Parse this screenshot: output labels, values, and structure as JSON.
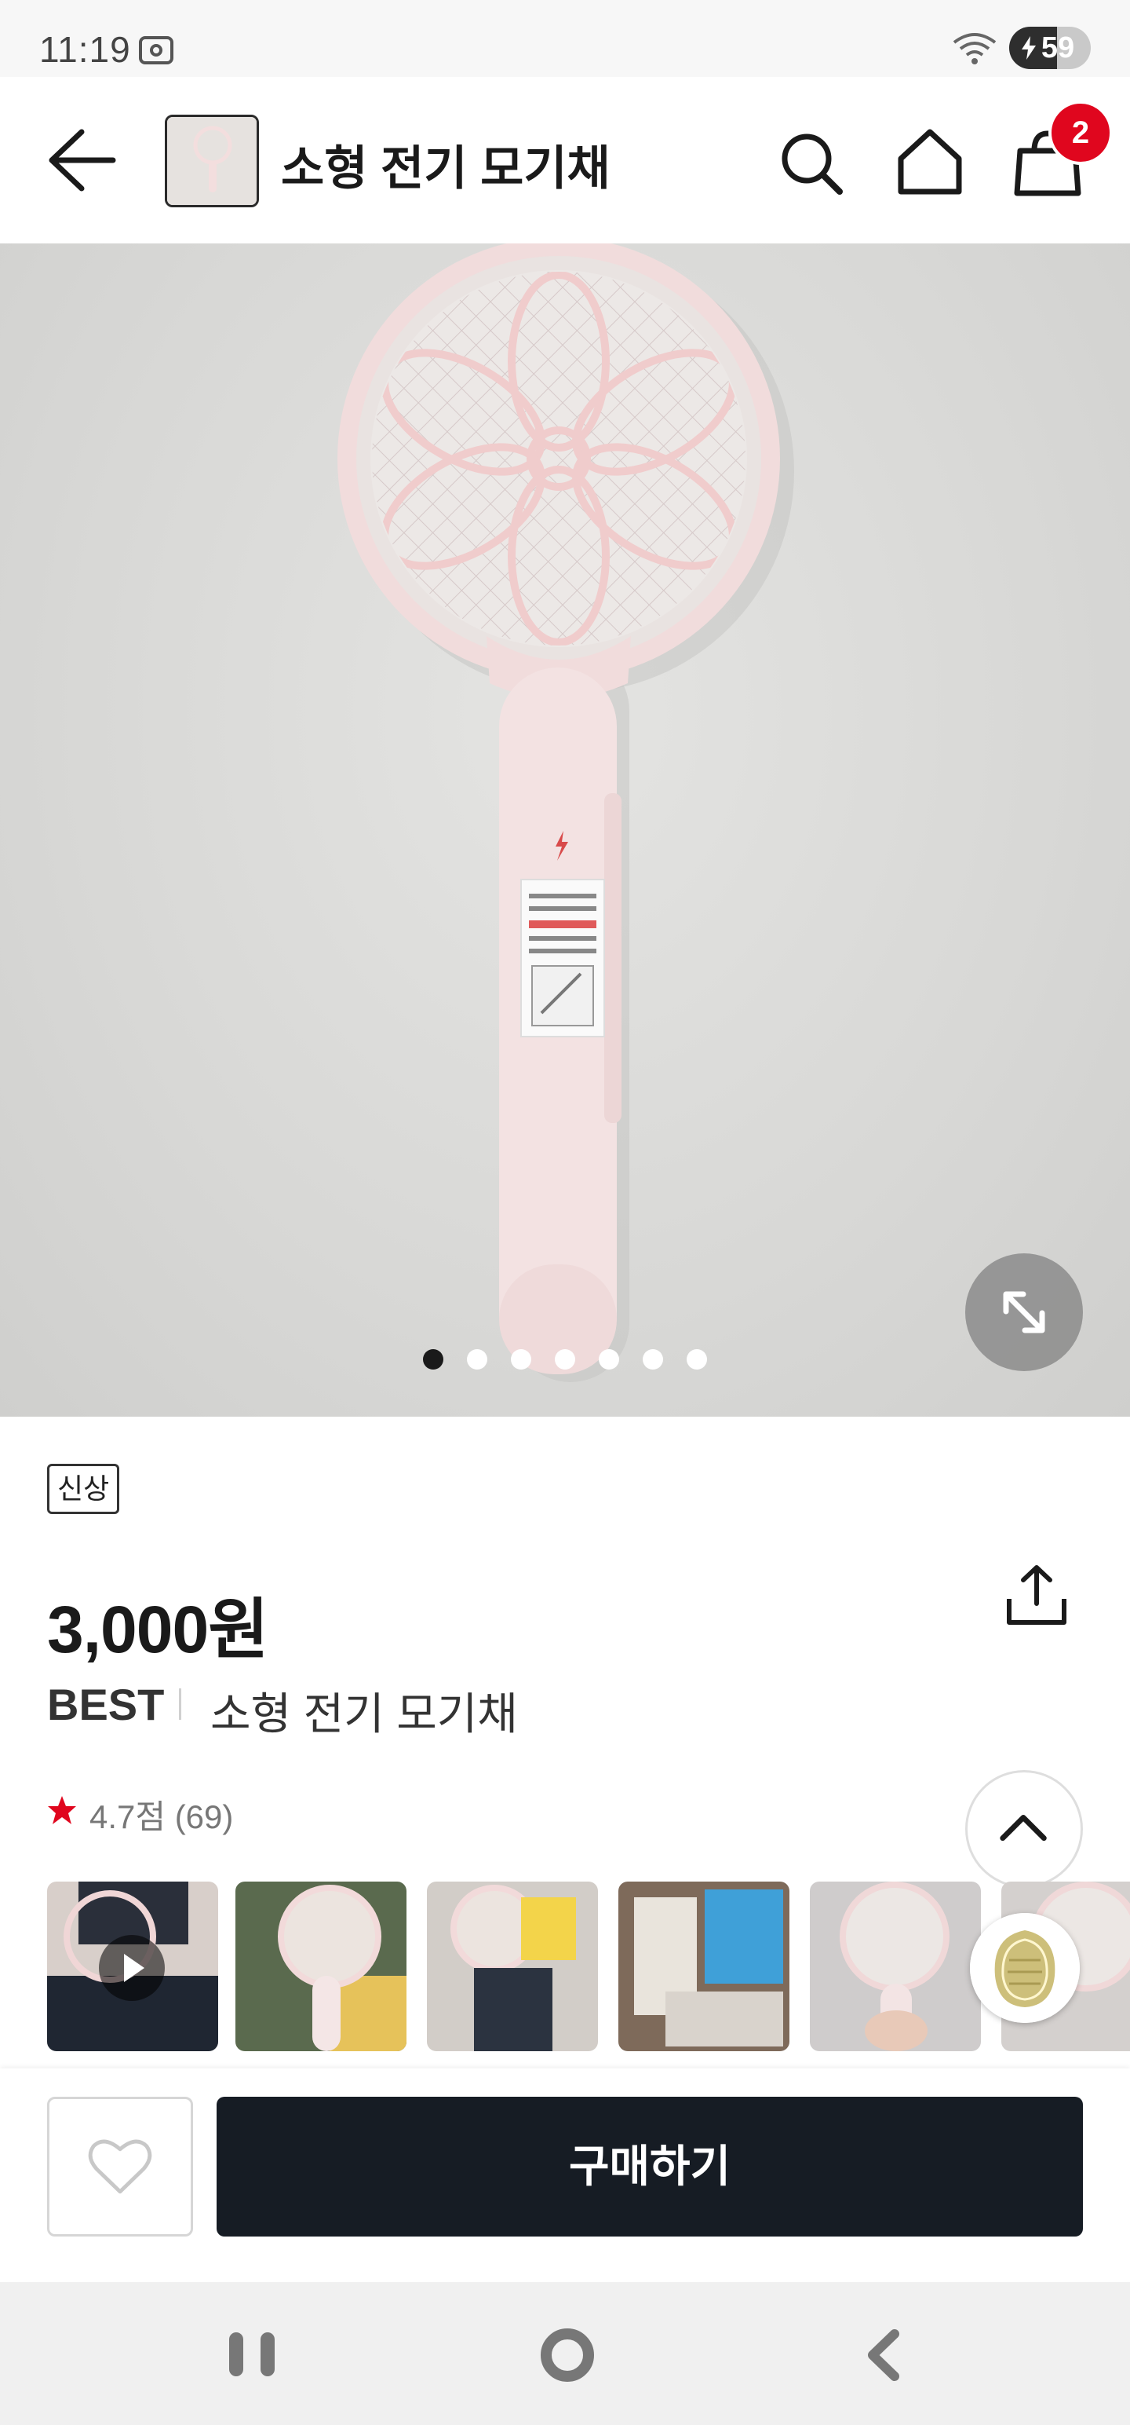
{
  "status_bar": {
    "time": "11:19",
    "battery": "59",
    "battery_level": 0.59
  },
  "header": {
    "title": "소형 전기 모기채",
    "cart_count": "2"
  },
  "gallery": {
    "total_images": 7,
    "active_index": 0
  },
  "product": {
    "tag": "신상",
    "price": "3,000원",
    "brand": "BEST",
    "name": "소형 전기 모기채",
    "rating": "4.7점 (69)"
  },
  "reviews": {
    "thumbnail_count": 6
  },
  "bottom_bar": {
    "buy_label": "구매하기"
  },
  "colors": {
    "accent": "#e0061e",
    "buy_button": "#161c24",
    "product_pink": "#f1dcdc"
  }
}
